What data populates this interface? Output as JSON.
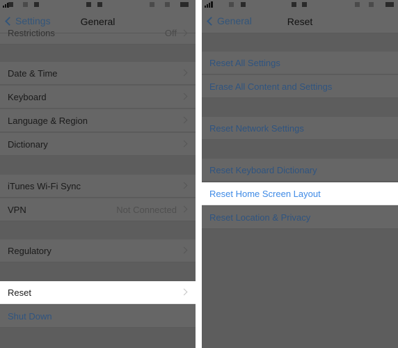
{
  "left": {
    "nav": {
      "back_label": "Settings",
      "title": "General"
    },
    "partial_row": {
      "label": "Restrictions",
      "detail": "Off"
    },
    "rows": [
      {
        "label": "Date & Time"
      },
      {
        "label": "Keyboard"
      },
      {
        "label": "Language & Region"
      },
      {
        "label": "Dictionary"
      },
      {
        "label": "iTunes Wi-Fi Sync"
      },
      {
        "label": "VPN",
        "detail": "Not Connected"
      },
      {
        "label": "Regulatory"
      },
      {
        "label": "Reset",
        "highlighted": true
      },
      {
        "label": "Shut Down"
      }
    ]
  },
  "right": {
    "nav": {
      "back_label": "General",
      "title": "Reset"
    },
    "rows": [
      {
        "label": "Reset All Settings"
      },
      {
        "label": "Erase All Content and Settings"
      },
      {
        "label": "Reset Network Settings"
      },
      {
        "label": "Reset Keyboard Dictionary"
      },
      {
        "label": "Reset Home Screen Layout",
        "highlighted": true
      },
      {
        "label": "Reset Location & Privacy"
      }
    ]
  },
  "colors": {
    "accent_blue": "#3e8ae6",
    "dim_overlay": "#5d5d5d",
    "highlight": "#ffffff"
  }
}
